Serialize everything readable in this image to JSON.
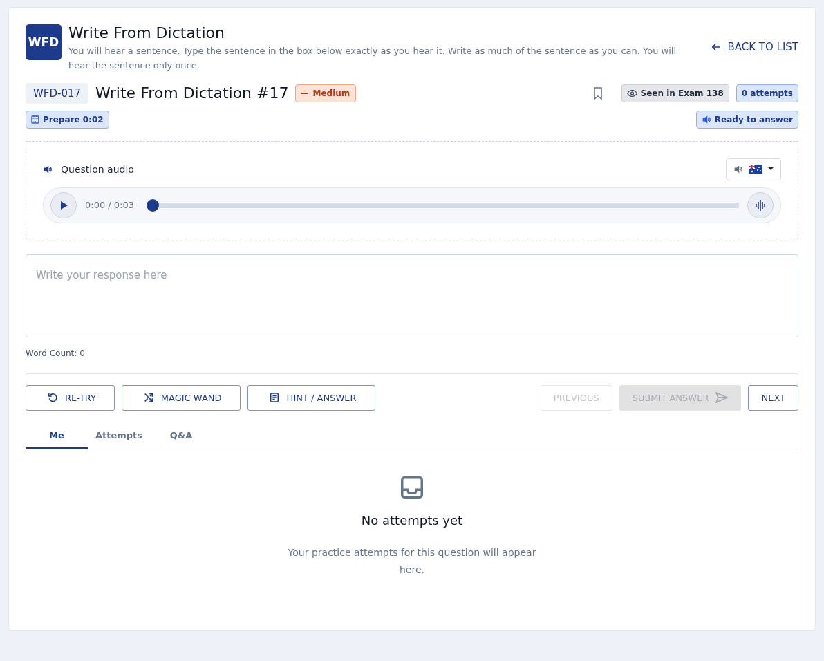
{
  "header": {
    "logo": "WFD",
    "title": "Write From Dictation",
    "instructions": "You will hear a sentence. Type the sentence in the box below exactly as you hear it. Write as much of the sentence as you can. You will hear the sentence only once.",
    "back_link": "BACK TO LIST"
  },
  "question": {
    "code": "WFD-017",
    "title": "Write From Dictation #17",
    "difficulty": "Medium",
    "bookmarked": false,
    "seen_badge": "Seen in Exam 138",
    "attempts_badge": "0 attempts",
    "prepare_badge": "Prepare 0:02",
    "status_badge": "Ready to answer"
  },
  "audio": {
    "label": "Question audio",
    "time": "0:00 / 0:03",
    "level": 0
  },
  "response": {
    "placeholder": "Write your response here",
    "word_count": "Word Count: 0"
  },
  "left_buttons": [
    {
      "label": "RE-TRY",
      "disabled": false
    },
    {
      "label": "MAGIC WAND",
      "disabled": false
    },
    {
      "label": "HINT / ANSWER",
      "disabled": false
    }
  ],
  "right_buttons": [
    {
      "label": "PREVIOUS",
      "kind": "outline",
      "disabled": true
    },
    {
      "label": "SUBMIT ANSWER",
      "kind": "filled",
      "disabled": true
    },
    {
      "label": "NEXT",
      "kind": "outline",
      "disabled": false
    }
  ],
  "tabs": [
    {
      "label": "Me",
      "selected": true
    },
    {
      "label": "Attempts",
      "selected": false
    },
    {
      "label": "Q&A",
      "selected": false
    }
  ],
  "empty_state": {
    "title": "No attempts yet",
    "message": "Your practice attempts for this question will appear here."
  }
}
